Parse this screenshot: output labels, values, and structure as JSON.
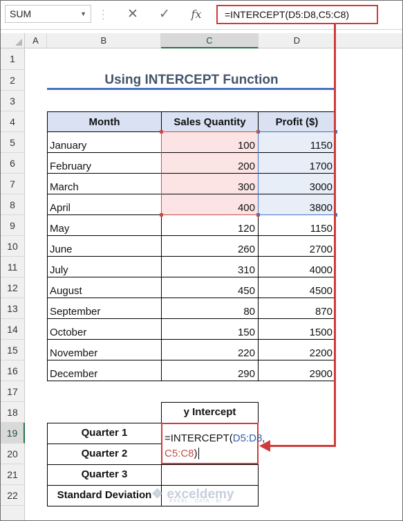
{
  "formula_bar": {
    "name_box": "SUM",
    "cancel_icon": "✕",
    "enter_icon": "✓",
    "fx_label": "fx",
    "formula": "=INTERCEPT(D5:D8,C5:C8)"
  },
  "columns": [
    "A",
    "B",
    "C",
    "D"
  ],
  "rows": [
    "1",
    "2",
    "3",
    "4",
    "5",
    "6",
    "7",
    "8",
    "9",
    "10",
    "11",
    "12",
    "13",
    "14",
    "15",
    "16",
    "17",
    "18",
    "19",
    "20",
    "21",
    "22"
  ],
  "title": "Using INTERCEPT Function",
  "table": {
    "headers": [
      "Month",
      "Sales Quantity",
      "Profit ($)"
    ],
    "rows": [
      {
        "month": "January",
        "sales": "100",
        "profit": "1150"
      },
      {
        "month": "February",
        "sales": "200",
        "profit": "1700"
      },
      {
        "month": "March",
        "sales": "300",
        "profit": "3000"
      },
      {
        "month": "April",
        "sales": "400",
        "profit": "3800"
      },
      {
        "month": "May",
        "sales": "120",
        "profit": "1150"
      },
      {
        "month": "June",
        "sales": "260",
        "profit": "2700"
      },
      {
        "month": "July",
        "sales": "310",
        "profit": "4000"
      },
      {
        "month": "August",
        "sales": "450",
        "profit": "4500"
      },
      {
        "month": "September",
        "sales": "80",
        "profit": "870"
      },
      {
        "month": "October",
        "sales": "150",
        "profit": "1500"
      },
      {
        "month": "November",
        "sales": "220",
        "profit": "2200"
      },
      {
        "month": "December",
        "sales": "290",
        "profit": "2900"
      }
    ]
  },
  "summary": {
    "header": "y Intercept",
    "labels": [
      "Quarter 1",
      "Quarter 2",
      "Quarter 3",
      "Standard Deviation"
    ],
    "edit_formula": {
      "prefix": "=INTERCEPT(",
      "ref1": "D5:D8",
      "sep": ",",
      "ref2": "C5:C8",
      "suffix": ")"
    }
  },
  "watermark": {
    "name": "exceldemy",
    "tagline": "EXCEL · DATA · BI"
  },
  "colors": {
    "ref1": "#2e5ea8",
    "ref2": "#c0504d",
    "header_fill": "#d9e1f2",
    "arrow": "#d03a3a"
  }
}
